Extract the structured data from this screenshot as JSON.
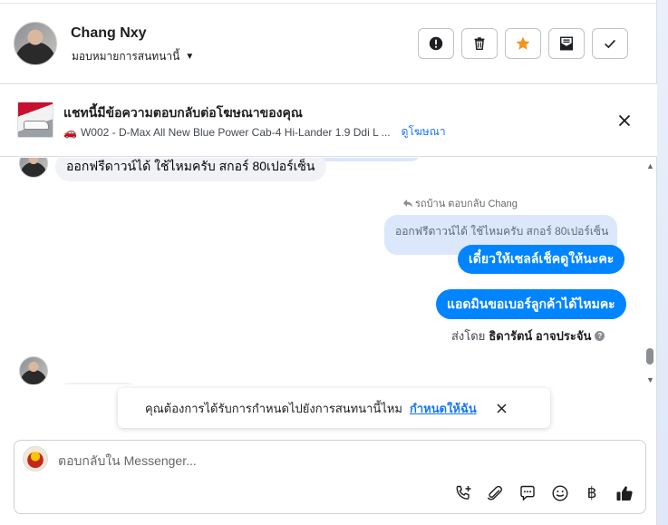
{
  "header": {
    "contact_name": "Chang Nxy",
    "assign_label": "มอบหมายการสนทนานี้",
    "actions": [
      {
        "name": "report-button",
        "icon": "alert-circle-icon"
      },
      {
        "name": "delete-button",
        "icon": "trash-icon"
      },
      {
        "name": "star-button",
        "icon": "star-icon"
      },
      {
        "name": "mark-unread-button",
        "icon": "mail-icon"
      },
      {
        "name": "mark-done-button",
        "icon": "check-icon"
      }
    ],
    "star_color": "#f7931e"
  },
  "ad_banner": {
    "title": "แชทนี้มีข้อความตอบกลับต่อโฆษณาของคุณ",
    "subtitle": "W002 - D-Max All New Blue Power Cab-4 Hi-Lander 1.9 Ddi L ...",
    "view_ad_link": "ดูโฆษณา"
  },
  "conversation": {
    "incoming_1": "ออกฟรีดาวน์ได้ ใช้ไหมครับ สกอร์ 80เปอร์เซ็น",
    "reply_label": "รถบ้าน ตอบกลับ Chang",
    "reply_quote": "ออกฟรีดาวน์ได้ ใช้ไหมครับ สกอร์ 80เปอร์เซ็น",
    "outgoing_1": "เดี๋ยวให้เซลล์เช็คดูให้นะคะ",
    "outgoing_2": "แอดมินขอเบอร์ลูกค้าได้ไหมคะ",
    "sent_by_prefix": "ส่งโดย",
    "sent_by_name": "ธิดารัตน์ อาจประจัน",
    "accent_color": "#0084ff"
  },
  "toast": {
    "text": "คุณต้องการได้รับการกำหนดไปยังการสนทนานี้ไหม",
    "link": "กำหนดให้ฉัน"
  },
  "composer": {
    "placeholder": "ตอบกลับใน Messenger...",
    "tools": [
      "call-plus-icon",
      "paperclip-icon",
      "chat-bubble-icon",
      "smiley-icon",
      "baht-icon",
      "thumbs-up-icon"
    ],
    "baht_symbol": "฿"
  }
}
